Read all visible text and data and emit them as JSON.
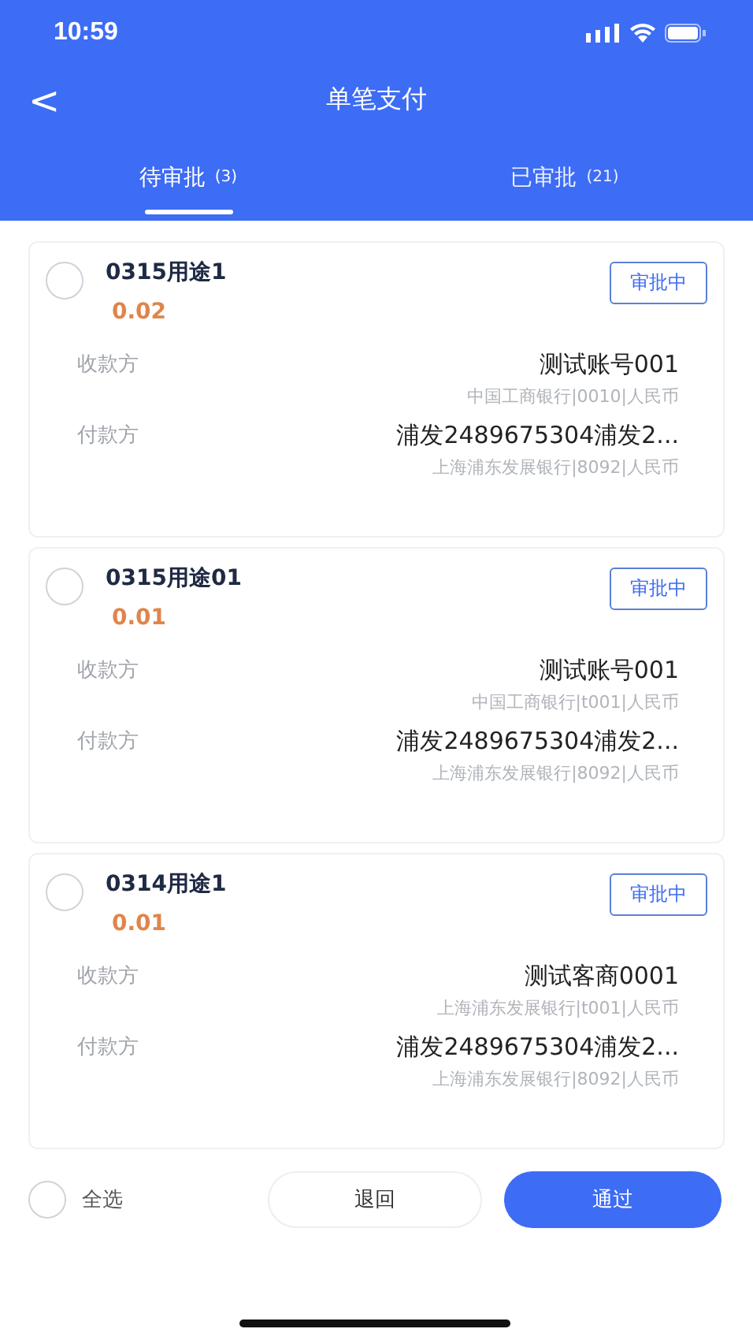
{
  "status_bar": {
    "time": "10:59"
  },
  "nav": {
    "back": "<",
    "title": "单笔支付"
  },
  "tabs": [
    {
      "label": "待审批",
      "count": "(3)",
      "selected": true
    },
    {
      "label": "已审批",
      "count": "(21)",
      "selected": false
    }
  ],
  "cards": [
    {
      "title": "0315用途1",
      "amount": "0.02",
      "status": "审批中",
      "checked": false,
      "payee": {
        "label": "收款方",
        "name": "测试账号001",
        "detail": "中国工商银行|0010|人民币"
      },
      "payer": {
        "label": "付款方",
        "name": "浦发2489675304浦发2...",
        "detail": "上海浦东发展银行|8092|人民币"
      }
    },
    {
      "title": "0315用途01",
      "amount": "0.01",
      "status": "审批中",
      "checked": false,
      "payee": {
        "label": "收款方",
        "name": "测试账号001",
        "detail": "中国工商银行|t001|人民币"
      },
      "payer": {
        "label": "付款方",
        "name": "浦发2489675304浦发2...",
        "detail": "上海浦东发展银行|8092|人民币"
      }
    },
    {
      "title": "0314用途1",
      "amount": "0.01",
      "status": "审批中",
      "checked": false,
      "payee": {
        "label": "收款方",
        "name": "测试客商0001",
        "detail": "上海浦东发展银行|t001|人民币"
      },
      "payer": {
        "label": "付款方",
        "name": "浦发2489675304浦发2...",
        "detail": "上海浦东发展银行|8092|人民币"
      }
    }
  ],
  "footer": {
    "select_all": {
      "label": "全选",
      "checked": false
    },
    "reject": "退回",
    "approve": "通过"
  }
}
